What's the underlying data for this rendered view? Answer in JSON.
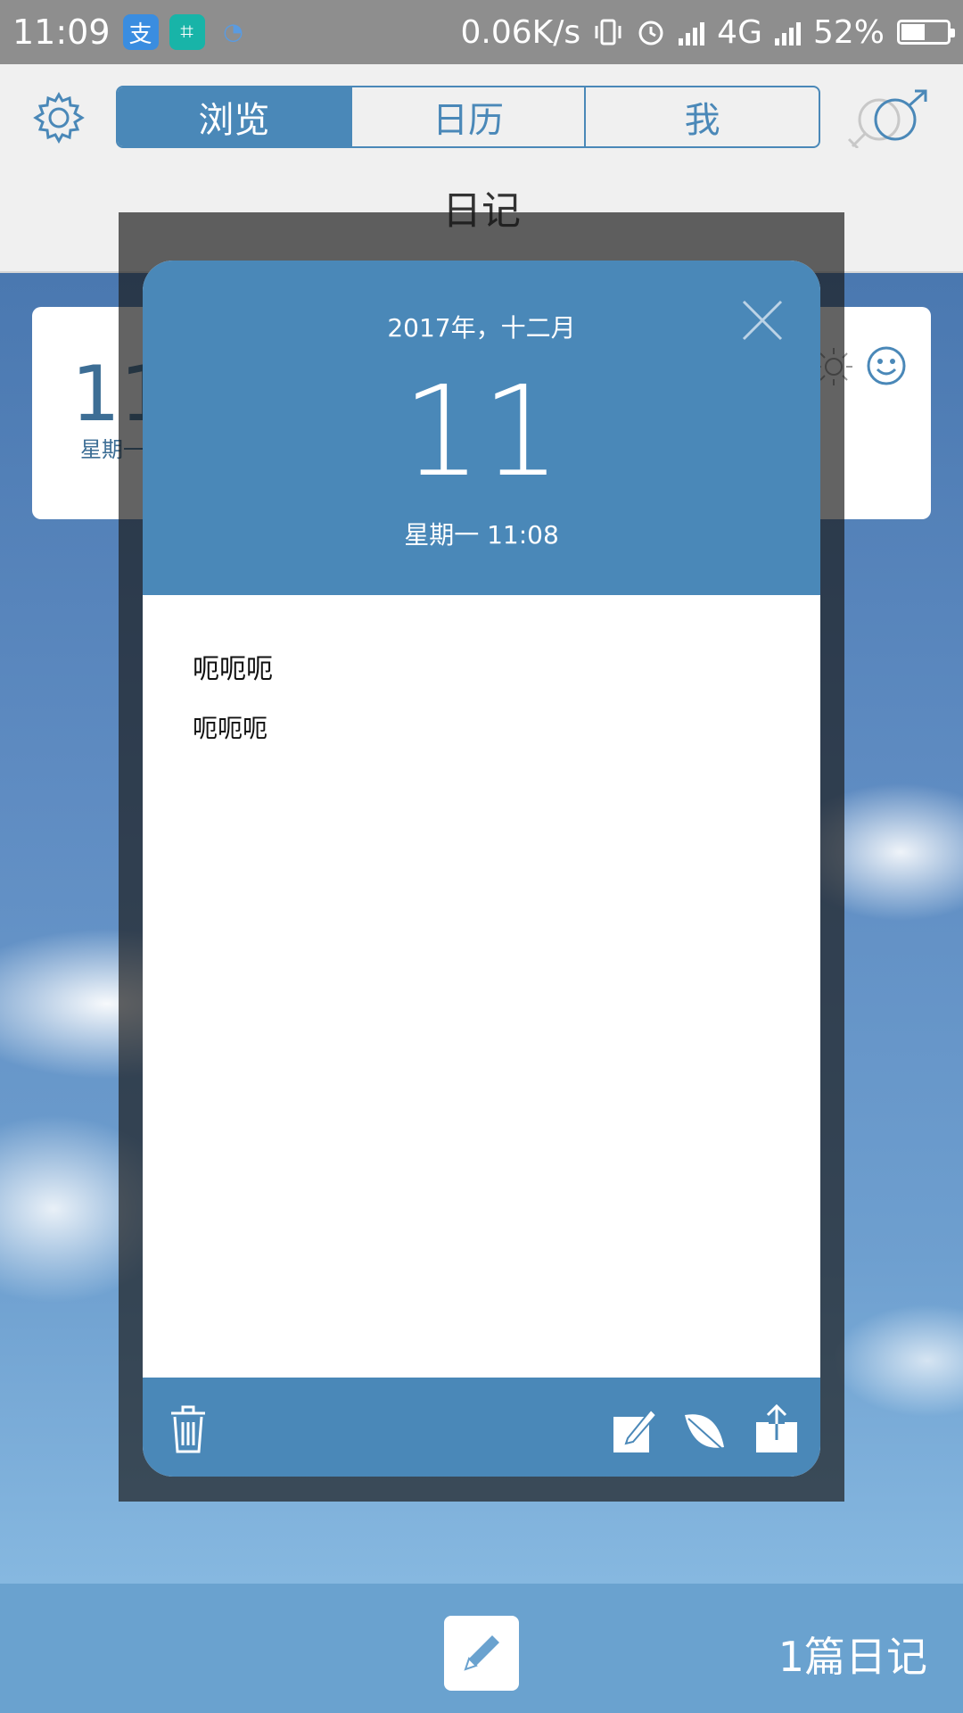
{
  "status_bar": {
    "time": "11:09",
    "app_icons": [
      {
        "name": "alipay-icon",
        "glyph": "支",
        "color": "#3a8de0"
      },
      {
        "name": "scan-icon",
        "glyph": "⌗",
        "color": "#18b4a8"
      },
      {
        "name": "chat-bell-icon",
        "glyph": "◔",
        "color": "#5a9be0"
      }
    ],
    "network_speed": "0.06K/s",
    "network_type": "4G",
    "battery_percent": "52%",
    "battery_level": 0.52
  },
  "header": {
    "tabs": [
      {
        "label": "浏览",
        "active": true
      },
      {
        "label": "日历",
        "active": false
      },
      {
        "label": "我",
        "active": false
      }
    ],
    "title": "日记"
  },
  "card": {
    "day": "11",
    "weekday": "星期一"
  },
  "entry": {
    "month_year": "2017年，十二月",
    "day": "11",
    "weekday_time": "星期一 11:08",
    "title": "呃呃呃",
    "text": "呃呃呃"
  },
  "bottom": {
    "count_text": "1篇日记"
  },
  "colors": {
    "accent": "#4a88b8",
    "bottom_bar": "#6aa2cf"
  }
}
